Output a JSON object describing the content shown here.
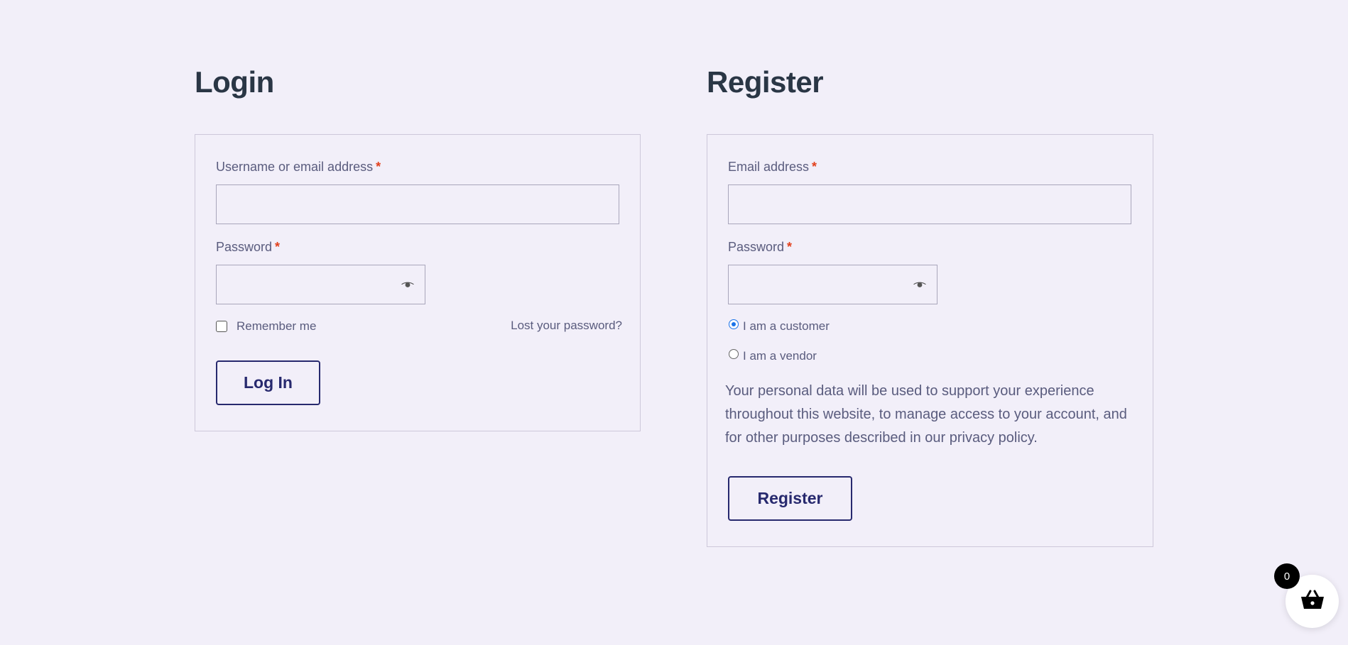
{
  "login": {
    "title": "Login",
    "username_label": "Username or email address",
    "password_label": "Password",
    "required_mark": "*",
    "remember_label": "Remember me",
    "lost_password": "Lost your password?",
    "submit_label": "Log In",
    "username_value": "",
    "password_value": "",
    "remember_checked": false
  },
  "register": {
    "title": "Register",
    "email_label": "Email address",
    "password_label": "Password",
    "required_mark": "*",
    "role_options": [
      {
        "label": "I am a customer",
        "selected": true
      },
      {
        "label": "I am a vendor",
        "selected": false
      }
    ],
    "privacy_text": "Your personal data will be used to support your experience throughout this website, to manage access to your account, and for other purposes described in our ",
    "privacy_link": "privacy policy",
    "privacy_end": ".",
    "submit_label": "Register",
    "email_value": "",
    "password_value": ""
  },
  "cart": {
    "count": "0",
    "icon": "basket-icon"
  },
  "colors": {
    "background": "#f2eff9",
    "heading": "#2a3645",
    "text": "#5a5c7e",
    "required": "#e2401c",
    "button": "#27296e",
    "radio_accent": "#1a73e8"
  }
}
